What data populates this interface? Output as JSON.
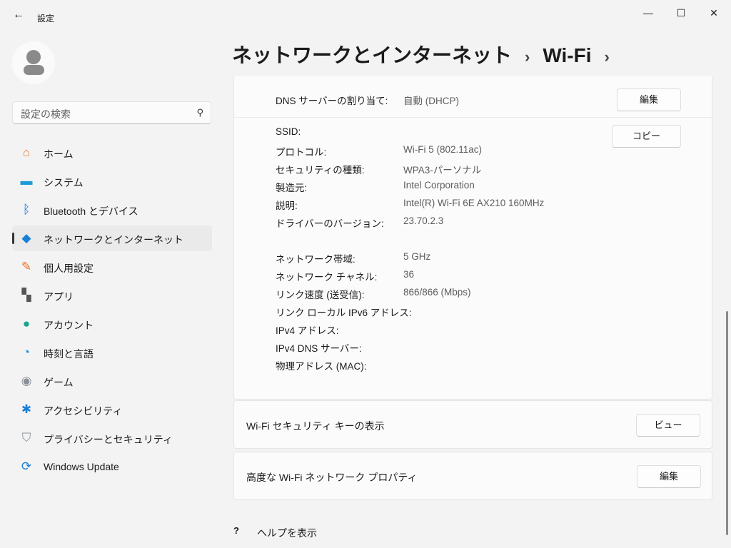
{
  "window": {
    "title": "設定",
    "back_icon": "back-arrow-icon",
    "minimize": "—",
    "maximize": "☐",
    "close": "✕"
  },
  "sidebar": {
    "search_placeholder": "設定の検索",
    "items": [
      {
        "label": "ホーム",
        "icon": "home-icon",
        "glyph": "⌂",
        "color": "#e8742a"
      },
      {
        "label": "システム",
        "icon": "system-icon",
        "glyph": "▬",
        "color": "#1e9bd7"
      },
      {
        "label": "Bluetooth とデバイス",
        "icon": "bluetooth-icon",
        "glyph": "ᛒ",
        "color": "#1a73e8"
      },
      {
        "label": "ネットワークとインターネット",
        "icon": "wifi-icon",
        "glyph": "◆",
        "color": "#1a7fd6"
      },
      {
        "label": "個人用設定",
        "icon": "brush-icon",
        "glyph": "✎",
        "color": "#e8742a"
      },
      {
        "label": "アプリ",
        "icon": "apps-icon",
        "glyph": "▚",
        "color": "#555555"
      },
      {
        "label": "アカウント",
        "icon": "account-icon",
        "glyph": "●",
        "color": "#1aa58a"
      },
      {
        "label": "時刻と言語",
        "icon": "time-language-icon",
        "glyph": "◔",
        "color": "#1a8fd6"
      },
      {
        "label": "ゲーム",
        "icon": "gamepad-icon",
        "glyph": "◉",
        "color": "#8a8f99"
      },
      {
        "label": "アクセシビリティ",
        "icon": "accessibility-icon",
        "glyph": "✱",
        "color": "#1a7fd6"
      },
      {
        "label": "プライバシーとセキュリティ",
        "icon": "shield-icon",
        "glyph": "⛉",
        "color": "#8a8f99"
      },
      {
        "label": "Windows Update",
        "icon": "windows-update-icon",
        "glyph": "⟳",
        "color": "#1a7fd6"
      }
    ],
    "selected_index": 3
  },
  "breadcrumb": {
    "parent": "ネットワークとインターネット",
    "current": "Wi-Fi",
    "sep": "›"
  },
  "dns": {
    "label": "DNS サーバーの割り当て:",
    "value": "自動 (DHCP)",
    "button": "編集"
  },
  "copy_button": "コピー",
  "properties": [
    {
      "label": "SSID:",
      "value": ""
    },
    {
      "label": "プロトコル:",
      "value": "Wi-Fi 5 (802.11ac)"
    },
    {
      "label": "セキュリティの種類:",
      "value": "WPA3-パーソナル"
    },
    {
      "label": "製造元:",
      "value": "Intel Corporation"
    },
    {
      "label": "説明:",
      "value": "Intel(R) Wi-Fi 6E AX210 160MHz"
    },
    {
      "label": "ドライバーのバージョン:",
      "value": "23.70.2.3"
    },
    {
      "label": "ネットワーク帯域:",
      "value": "5 GHz"
    },
    {
      "label": "ネットワーク チャネル:",
      "value": "36"
    },
    {
      "label": "リンク速度 (送受信):",
      "value": "866/866 (Mbps)"
    },
    {
      "label": "リンク ローカル IPv6 アドレス:",
      "value": ""
    },
    {
      "label": "IPv4 アドレス:",
      "value": ""
    },
    {
      "label": "IPv4 DNS サーバー:",
      "value": ""
    },
    {
      "label": "物理アドレス (MAC):",
      "value": ""
    }
  ],
  "security_key": {
    "label": "Wi-Fi セキュリティ キーの表示",
    "button": "ビュー"
  },
  "advanced": {
    "label": "高度な Wi-Fi ネットワーク プロパティ",
    "button": "編集"
  },
  "help": {
    "label": "ヘルプを表示",
    "glyph": "?"
  }
}
